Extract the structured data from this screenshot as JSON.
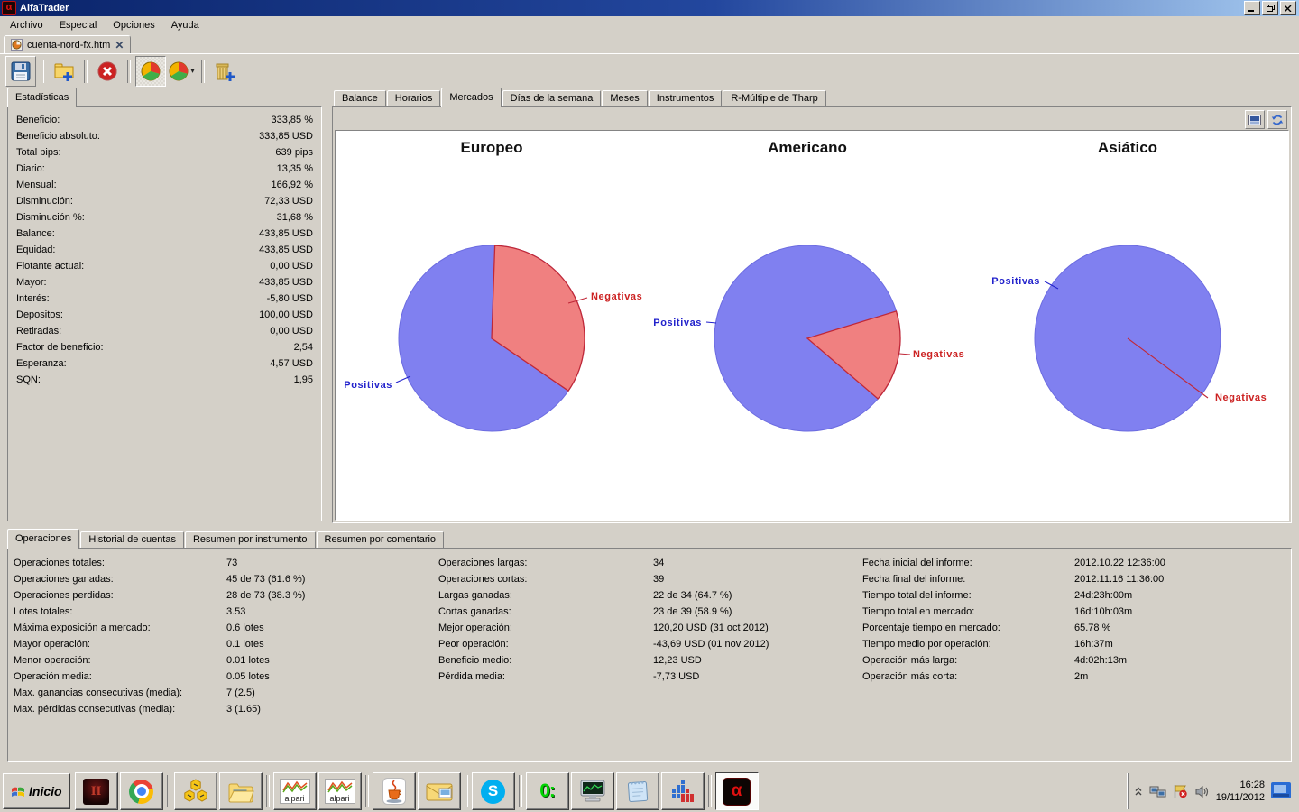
{
  "window": {
    "title": "AlfaTrader",
    "app_icon": "alfatrader-logo",
    "menu_items": [
      "Archivo",
      "Especial",
      "Opciones",
      "Ayuda"
    ],
    "document_tab": {
      "label": "cuenta-nord-fx.htm",
      "close_icon": "✕"
    },
    "window_buttons": [
      "minimize",
      "restore",
      "close"
    ]
  },
  "toolbar": {
    "buttons": [
      {
        "name": "save",
        "icon": "floppy-icon",
        "framed": true,
        "sep_after": true
      },
      {
        "name": "add-account",
        "icon": "folder-plus-icon",
        "sep_after": true
      },
      {
        "name": "delete-report",
        "icon": "red-x-icon",
        "sep_after": true
      },
      {
        "name": "pie-report",
        "icon": "pie-chart-icon",
        "active": true
      },
      {
        "name": "pie-report-menu",
        "icon": "pie-chart-icon",
        "dropdown": true,
        "sep_after": true
      },
      {
        "name": "add-instrument",
        "icon": "building-plus-icon"
      }
    ]
  },
  "left_panel": {
    "tab_label": "Estadísticas",
    "rows": [
      {
        "label": "Beneficio:",
        "value": "333,85 %"
      },
      {
        "label": "Beneficio absoluto:",
        "value": "333,85 USD"
      },
      {
        "label": "Total pips:",
        "value": "639 pips"
      },
      {
        "label": "Diario:",
        "value": "13,35 %"
      },
      {
        "label": "Mensual:",
        "value": "166,92 %"
      },
      {
        "label": "Disminución:",
        "value": "72,33 USD"
      },
      {
        "label": "Disminución %:",
        "value": "31,68 %"
      },
      {
        "label": "Balance:",
        "value": "433,85 USD"
      },
      {
        "label": "Equidad:",
        "value": "433,85 USD"
      },
      {
        "label": "Flotante actual:",
        "value": "0,00 USD"
      },
      {
        "label": "Mayor:",
        "value": "433,85 USD"
      },
      {
        "label": "Interés:",
        "value": "-5,80 USD"
      },
      {
        "label": "Depositos:",
        "value": "100,00 USD"
      },
      {
        "label": "Retiradas:",
        "value": "0,00 USD"
      },
      {
        "label": "Factor de beneficio:",
        "value": "2,54"
      },
      {
        "label": "Esperanza:",
        "value": "4,57 USD"
      },
      {
        "label": "SQN:",
        "value": "1,95"
      }
    ]
  },
  "right_panel": {
    "tabs": [
      "Balance",
      "Horarios",
      "Mercados",
      "Días de la semana",
      "Meses",
      "Instrumentos",
      "R-Múltiple de Tharp"
    ],
    "active_tab": "Mercados",
    "tools": [
      {
        "name": "chart-snapshot",
        "icon": "image-icon"
      },
      {
        "name": "chart-refresh",
        "icon": "refresh-icon"
      }
    ]
  },
  "chart_data": [
    {
      "type": "pie",
      "title": "Europeo",
      "labels": [
        "Positivas",
        "Negativas"
      ],
      "values": [
        66,
        34
      ],
      "colors": {
        "positivas": "#8080f0",
        "negativas": "#f08080"
      },
      "label_colors": {
        "positivas": "#2222cc",
        "negativas": "#cc2222"
      }
    },
    {
      "type": "pie",
      "title": "Americano",
      "labels": [
        "Positivas",
        "Negativas"
      ],
      "values": [
        84,
        16
      ],
      "colors": {
        "positivas": "#8080f0",
        "negativas": "#f08080"
      },
      "label_colors": {
        "positivas": "#2222cc",
        "negativas": "#cc2222"
      }
    },
    {
      "type": "pie",
      "title": "Asiático",
      "labels": [
        "Positivas",
        "Negativas"
      ],
      "values": [
        100,
        0
      ],
      "colors": {
        "positivas": "#8080f0",
        "negativas": "#f08080"
      },
      "label_colors": {
        "positivas": "#2222cc",
        "negativas": "#cc2222"
      }
    }
  ],
  "bottom_panel": {
    "tabs": [
      "Operaciones",
      "Historial de cuentas",
      "Resumen por instrumento",
      "Resumen por comentario"
    ],
    "active_tab": "Operaciones",
    "columns": [
      [
        {
          "label": "Operaciones totales:",
          "value": "73"
        },
        {
          "label": "Operaciones ganadas:",
          "value": "45 de 73 (61.6 %)"
        },
        {
          "label": "Operaciones perdidas:",
          "value": "28 de 73 (38.3 %)"
        },
        {
          "label": "Lotes totales:",
          "value": "3.53"
        },
        {
          "label": "Máxima exposición a mercado:",
          "value": "0.6 lotes"
        },
        {
          "label": "Mayor operación:",
          "value": "0.1 lotes"
        },
        {
          "label": "Menor operación:",
          "value": "0.01 lotes"
        },
        {
          "label": "Operación media:",
          "value": "0.05 lotes"
        },
        {
          "label": "Max. ganancias consecutivas (media):",
          "value": "7 (2.5)"
        },
        {
          "label": "Max. pérdidas consecutivas (media):",
          "value": "3 (1.65)"
        }
      ],
      [
        {
          "label": "Operaciones largas:",
          "value": "34"
        },
        {
          "label": "Operaciones cortas:",
          "value": "39"
        },
        {
          "label": "Largas ganadas:",
          "value": "22 de 34 (64.7 %)"
        },
        {
          "label": "Cortas ganadas:",
          "value": "23 de 39 (58.9 %)"
        },
        {
          "label": "Mejor operación:",
          "value": "120,20 USD (31 oct 2012)"
        },
        {
          "label": "Peor operación:",
          "value": "-43,69 USD (01 nov 2012)"
        },
        {
          "label": "Beneficio medio:",
          "value": "12,23 USD"
        },
        {
          "label": "Pérdida media:",
          "value": "-7,73 USD"
        }
      ],
      [
        {
          "label": "Fecha inicial del informe:",
          "value": "2012.10.22 12:36:00"
        },
        {
          "label": "Fecha final del informe:",
          "value": "2012.11.16 11:36:00"
        },
        {
          "label": "Tiempo total del informe:",
          "value": "24d:23h:00m"
        },
        {
          "label": "Tiempo total en mercado:",
          "value": "16d:10h:03m"
        },
        {
          "label": "Porcentaje tiempo en mercado:",
          "value": "65.78 %"
        },
        {
          "label": "Tiempo medio por operación:",
          "value": "16h:37m"
        },
        {
          "label": "Operación más larga:",
          "value": "4d:02h:13m"
        },
        {
          "label": "Operación más corta:",
          "value": "2m"
        }
      ]
    ]
  },
  "taskbar": {
    "start_label": "Inicio",
    "quick_launch": [
      {
        "name": "lineage2",
        "icon": "lineage2-icon"
      },
      {
        "name": "chrome",
        "icon": "chrome-icon",
        "sep_after": true
      },
      {
        "name": "hex-tools",
        "icon": "hex-tools-icon"
      },
      {
        "name": "file-explorer",
        "icon": "folder-icon",
        "sep_after": true
      },
      {
        "name": "alpari-metatrader",
        "icon": "alpari-icon",
        "label": "alpari"
      },
      {
        "name": "alpari-metatrader-2",
        "icon": "alpari-icon",
        "label": "alpari",
        "sep_after": true
      },
      {
        "name": "java",
        "icon": "java-icon"
      },
      {
        "name": "mail",
        "icon": "mail-icon",
        "sep_after": true
      },
      {
        "name": "skype",
        "icon": "skype-icon",
        "sep_after": true
      },
      {
        "name": "timer",
        "icon": "timer-icon",
        "label": "0:"
      },
      {
        "name": "system-monitor",
        "icon": "monitor-chart-icon"
      },
      {
        "name": "notepad",
        "icon": "notepad-icon"
      },
      {
        "name": "equalizer",
        "icon": "equalizer-icon",
        "sep_after": true
      },
      {
        "name": "alfatrader",
        "icon": "alfatrader-icon",
        "label": "α",
        "active": true
      }
    ],
    "tray": {
      "icons": [
        "chevron-up-icon",
        "network-icon",
        "security-alert-flag-icon",
        "speaker-icon"
      ],
      "time": "16:28",
      "date": "19/11/2012",
      "show_desktop_icon": "show-desktop-icon"
    }
  }
}
